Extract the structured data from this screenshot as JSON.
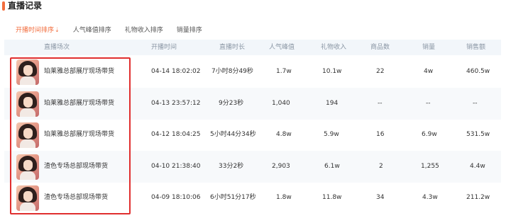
{
  "page": {
    "title": "直播记录"
  },
  "colors": {
    "accent": "#f26d3d",
    "highlight": "#e02e2e",
    "header_bg": "#f2f6fa"
  },
  "sort_tabs": [
    {
      "label": "开播时间排序",
      "active": true,
      "icon": "sort-down-arrow"
    },
    {
      "label": "人气峰值排序",
      "active": false
    },
    {
      "label": "礼物收入排序",
      "active": false
    },
    {
      "label": "销量排序",
      "active": false
    }
  ],
  "table": {
    "columns": [
      "直播场次",
      "开播时间",
      "直播时长",
      "人气峰值",
      "礼物收入",
      "商品数",
      "销量",
      "销售额"
    ],
    "rows": [
      {
        "session": "珀莱雅总部展厅现场带货",
        "start": "04-14 18:02:02",
        "duration": "7小时8分49秒",
        "peak": "1.7w",
        "gift": "10.1w",
        "goods": "22",
        "sales": "4w",
        "revenue": "460.5w"
      },
      {
        "session": "珀莱雅总部展厅现场带货",
        "start": "04-13 23:57:12",
        "duration": "9分23秒",
        "peak": "1,040",
        "gift": "194",
        "goods": "--",
        "sales": "--",
        "revenue": "--"
      },
      {
        "session": "珀莱雅总部展厅现场带货",
        "start": "04-12 18:04:25",
        "duration": "5小时44分34秒",
        "peak": "4.8w",
        "gift": "5.9w",
        "goods": "16",
        "sales": "6.9w",
        "revenue": "531.5w"
      },
      {
        "session": "渣色专场总部现场带货",
        "start": "04-10 21:38:40",
        "duration": "33分2秒",
        "peak": "2,903",
        "gift": "6.1w",
        "goods": "2",
        "sales": "1,255",
        "revenue": "4.4w"
      },
      {
        "session": "渣色专场总部现场带货",
        "start": "04-09 18:10:06",
        "duration": "6小时51分17秒",
        "peak": "1.8w",
        "gift": "11.8w",
        "goods": "34",
        "sales": "4.3w",
        "revenue": "211.2w"
      }
    ]
  }
}
